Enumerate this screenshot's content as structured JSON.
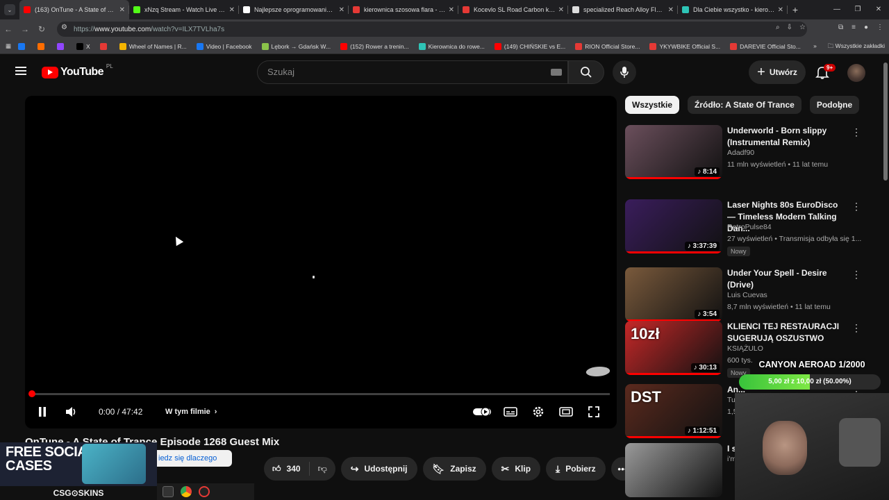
{
  "browser": {
    "tabs": [
      {
        "title": "(163) OnTune - A State of Tranc",
        "color": "#ff0000",
        "active": true
      },
      {
        "title": "xNzq Stream - Watch Live on K",
        "color": "#53fc18"
      },
      {
        "title": "Najlepsze oprogramowanie do",
        "color": "#ffffff"
      },
      {
        "title": "kierownica szosowa flara - Kup",
        "color": "#e53935"
      },
      {
        "title": "Kocevlo SL Road Carbon kierow",
        "color": "#e53935"
      },
      {
        "title": "specialized Reach Alloy Flare -",
        "color": "#dddddd"
      },
      {
        "title": "Dla Ciebie wszystko - kierownic",
        "color": "#2ec4b6"
      }
    ],
    "url_prefix": "https://",
    "url_host": "www.youtube.com",
    "url_path": "/watch?v=ILX7TVLha7s",
    "bookmarks": [
      {
        "label": "",
        "color": "#1877f2"
      },
      {
        "label": "",
        "color": "#ff6d00"
      },
      {
        "label": "",
        "color": "#9146ff"
      },
      {
        "label": "X",
        "color": "#000000"
      },
      {
        "label": "",
        "color": "#e53935"
      },
      {
        "label": "Wheel of Names | R...",
        "color": "#f4b400"
      },
      {
        "label": "Video | Facebook",
        "color": "#1877f2"
      },
      {
        "label": "Lębork → Gdańsk W...",
        "color": "#8bc34a"
      },
      {
        "label": "(152) Rower a trenin...",
        "color": "#ff0000"
      },
      {
        "label": "Kierownica do rowe...",
        "color": "#2ec4b6"
      },
      {
        "label": "(149) CHIŃSKIE vs E...",
        "color": "#ff0000"
      },
      {
        "label": "RION Official Store...",
        "color": "#e53935"
      },
      {
        "label": "YKYWBIKE Official S...",
        "color": "#e53935"
      },
      {
        "label": "DAREVIE Official Sto...",
        "color": "#e53935"
      }
    ],
    "bookmarks_more": "»",
    "all_bookmarks": "Wszystkie zakładki"
  },
  "yt": {
    "logo_text": "YouTube",
    "country": "PL",
    "search_placeholder": "Szukaj",
    "create_label": "Utwórz",
    "notif_badge": "9+"
  },
  "player": {
    "time": "0:00 / 47:42",
    "chapters": "W tym filmie",
    "progress": 0.0
  },
  "video": {
    "title": "OnTune - A State of Trance Episode 1268 Guest Mix",
    "likes": "340",
    "share": "Udostępnij",
    "save": "Zapisz",
    "clip": "Klip",
    "download": "Pobierz"
  },
  "chips": [
    "Wszystkie",
    "Źródło: A State Of Trance",
    "Podobne"
  ],
  "recommendations": [
    {
      "title": "Underworld - Born slippy (Instrumental Remix)",
      "channel": "Adadf90",
      "meta": "11 mln wyświetleń • 11 lat temu",
      "duration": "8:14",
      "thumb": "#6b4f5c"
    },
    {
      "title": "Laser Nights 80s EuroDisco — Timeless Modern Talking Dan...",
      "channel": "RetroPulse84",
      "meta": "27 wyświetleń • Transmisja odbyła się 1...",
      "duration": "3:37:39",
      "badge": "Nowy",
      "thumb": "#3a1d5c"
    },
    {
      "title": "Under Your Spell - Desire (Drive)",
      "channel": "Luis Cuevas",
      "meta": "8,7 mln wyświetleń • 11 lat temu",
      "duration": "3:54",
      "thumb": "#7a5a3c"
    },
    {
      "title": "KLIENCI TEJ RESTAURACJI SUGERUJĄ OSZUSTWO",
      "channel": "KSIĄŻULO",
      "meta": "600 tys.",
      "duration": "30:13",
      "badge": "Nowy",
      "thumb": "#c62828",
      "thumb_text": "10zł"
    },
    {
      "title": "An...",
      "channel": "Tut...",
      "meta": "1,5...",
      "duration": "1:12:51",
      "thumb": "#5b2a1e",
      "thumb_text": "DST"
    },
    {
      "title": "I s... yo...",
      "channel": "i'm...",
      "meta": "",
      "duration": "",
      "thumb": "#9a9a9a"
    }
  ],
  "ad": {
    "headline": "FREE SOCIAL CASES",
    "brand": "CSG⊙SKINS",
    "why": "iedz się dlaczego"
  },
  "stream_goal": {
    "title": "CANYON AEROAD 1/2000",
    "text": "5,00 zł z 10,00 zł (50.00%)",
    "fraction": 0.5
  }
}
